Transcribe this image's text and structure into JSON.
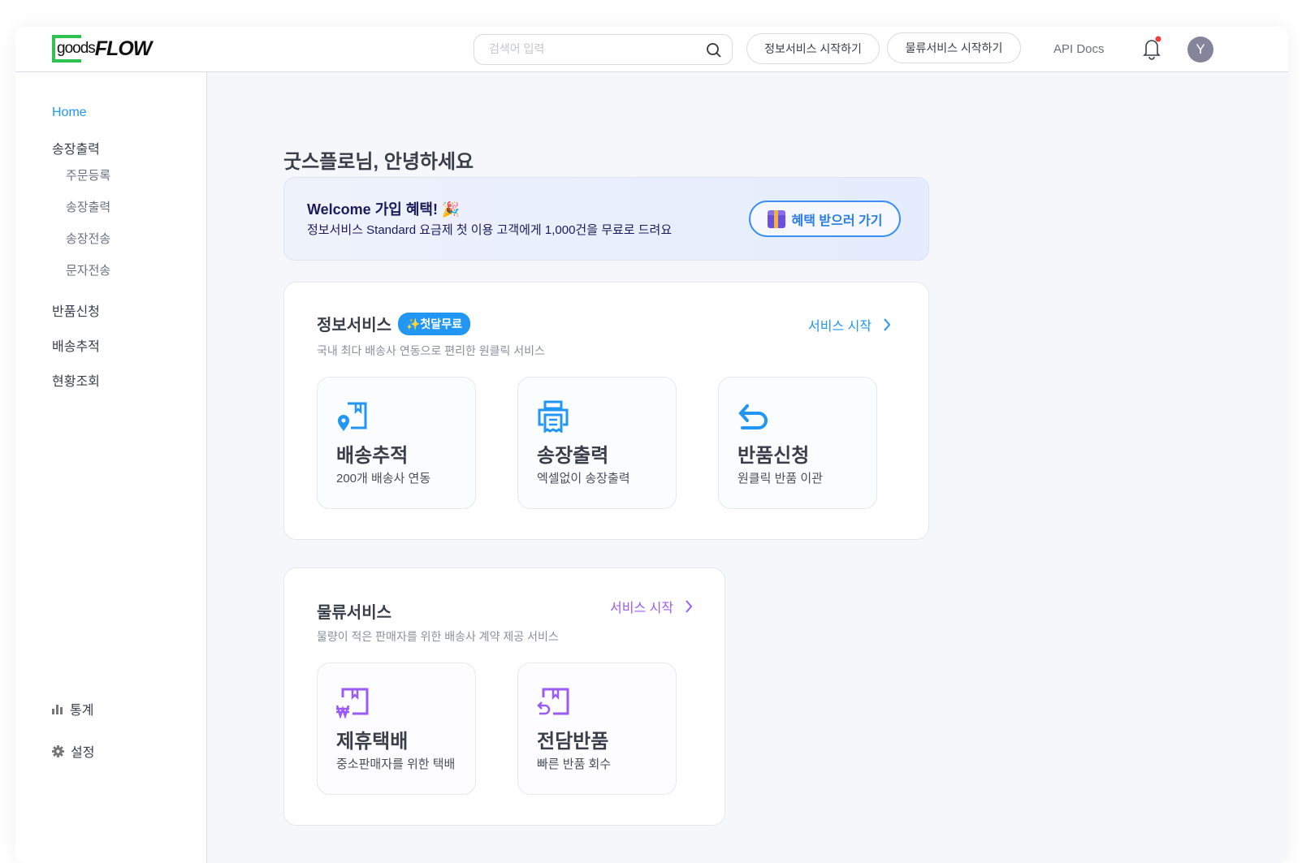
{
  "header": {
    "logo_text_a": "goods",
    "logo_text_b": "FLOW",
    "search_placeholder": "검색어 입력",
    "btn_info": "정보서비스 시작하기",
    "btn_logistics": "물류서비스 시작하기",
    "api_docs": "API Docs",
    "avatar_initial": "Y"
  },
  "sidebar": {
    "home": "Home",
    "invoice": "송장출력",
    "sub": [
      "주문등록",
      "송장출력",
      "송장전송",
      "문자전송"
    ],
    "returns": "반품신청",
    "tracking": "배송추적",
    "status": "현황조회",
    "stats": "통계",
    "settings": "설정"
  },
  "main": {
    "greeting": "굿스플로님, 안녕하세요",
    "banner": {
      "title": "Welcome 가입 혜택! 🎉",
      "subtitle": "정보서비스 Standard 요금제 첫 이용 고객에게 1,000건을 무료로 드려요",
      "button": "혜택 받으러 가기"
    },
    "info": {
      "title": "정보서비스",
      "badge": "✨첫달무료",
      "subtitle": "국내 최다 배송사 연동으로 편리한 원클릭 서비스",
      "start": "서비스 시작",
      "items": [
        {
          "title": "배송추적",
          "desc": "200개 배송사 연동"
        },
        {
          "title": "송장출력",
          "desc": "엑셀없이 송장출력"
        },
        {
          "title": "반품신청",
          "desc": "원클릭 반품 이관"
        }
      ]
    },
    "logistics": {
      "title": "물류서비스",
      "subtitle": "물량이 적은 판매자를 위한 배송사 계약 제공 서비스",
      "start": "서비스 시작",
      "items": [
        {
          "title": "제휴택배",
          "desc": "중소판매자를 위한 택배"
        },
        {
          "title": "전담반품",
          "desc": "빠른 반품 회수"
        }
      ]
    }
  },
  "colors": {
    "blue": "#2196f3",
    "purple": "#9b5cf6",
    "green": "#2fc24e"
  }
}
